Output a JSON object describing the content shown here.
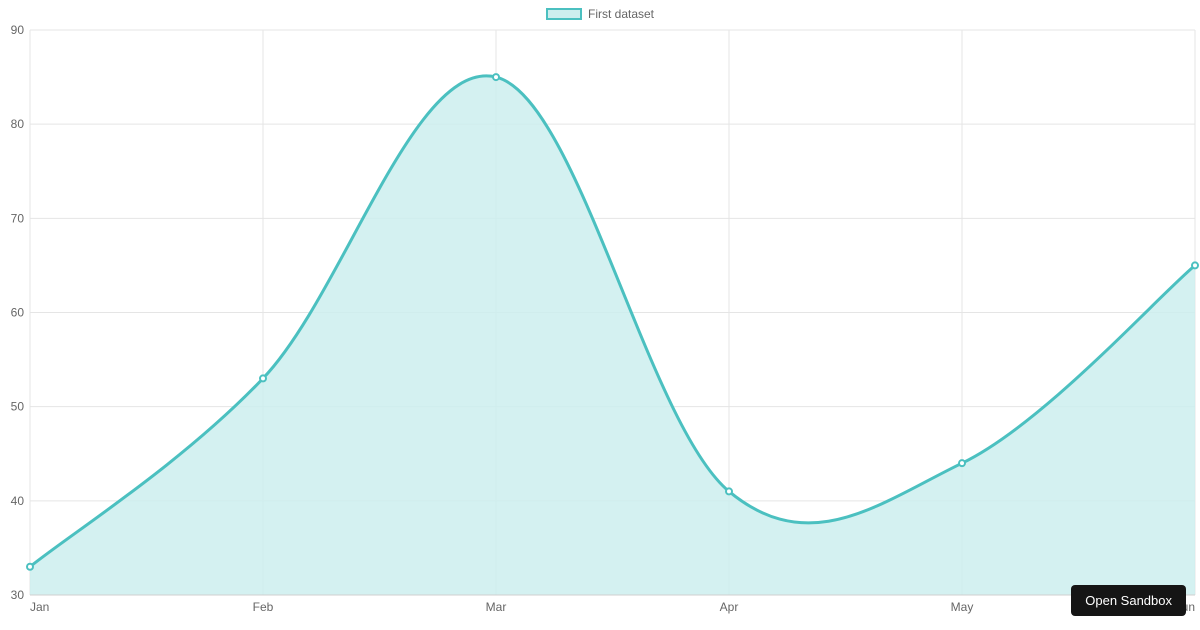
{
  "legend": {
    "label": "First dataset"
  },
  "button": {
    "open_sandbox": "Open Sandbox"
  },
  "chart_data": {
    "type": "area",
    "categories": [
      "Jan",
      "Feb",
      "Mar",
      "Apr",
      "May",
      "Jun"
    ],
    "values": [
      33,
      53,
      85,
      41,
      44,
      65
    ],
    "series_name": "First dataset",
    "ylim": [
      30,
      90
    ],
    "yticks": [
      30,
      40,
      50,
      60,
      70,
      80,
      90
    ],
    "xlabel": "",
    "ylabel": "",
    "colors": {
      "fill": "#cdeeee",
      "stroke": "#4bc0c0"
    }
  }
}
